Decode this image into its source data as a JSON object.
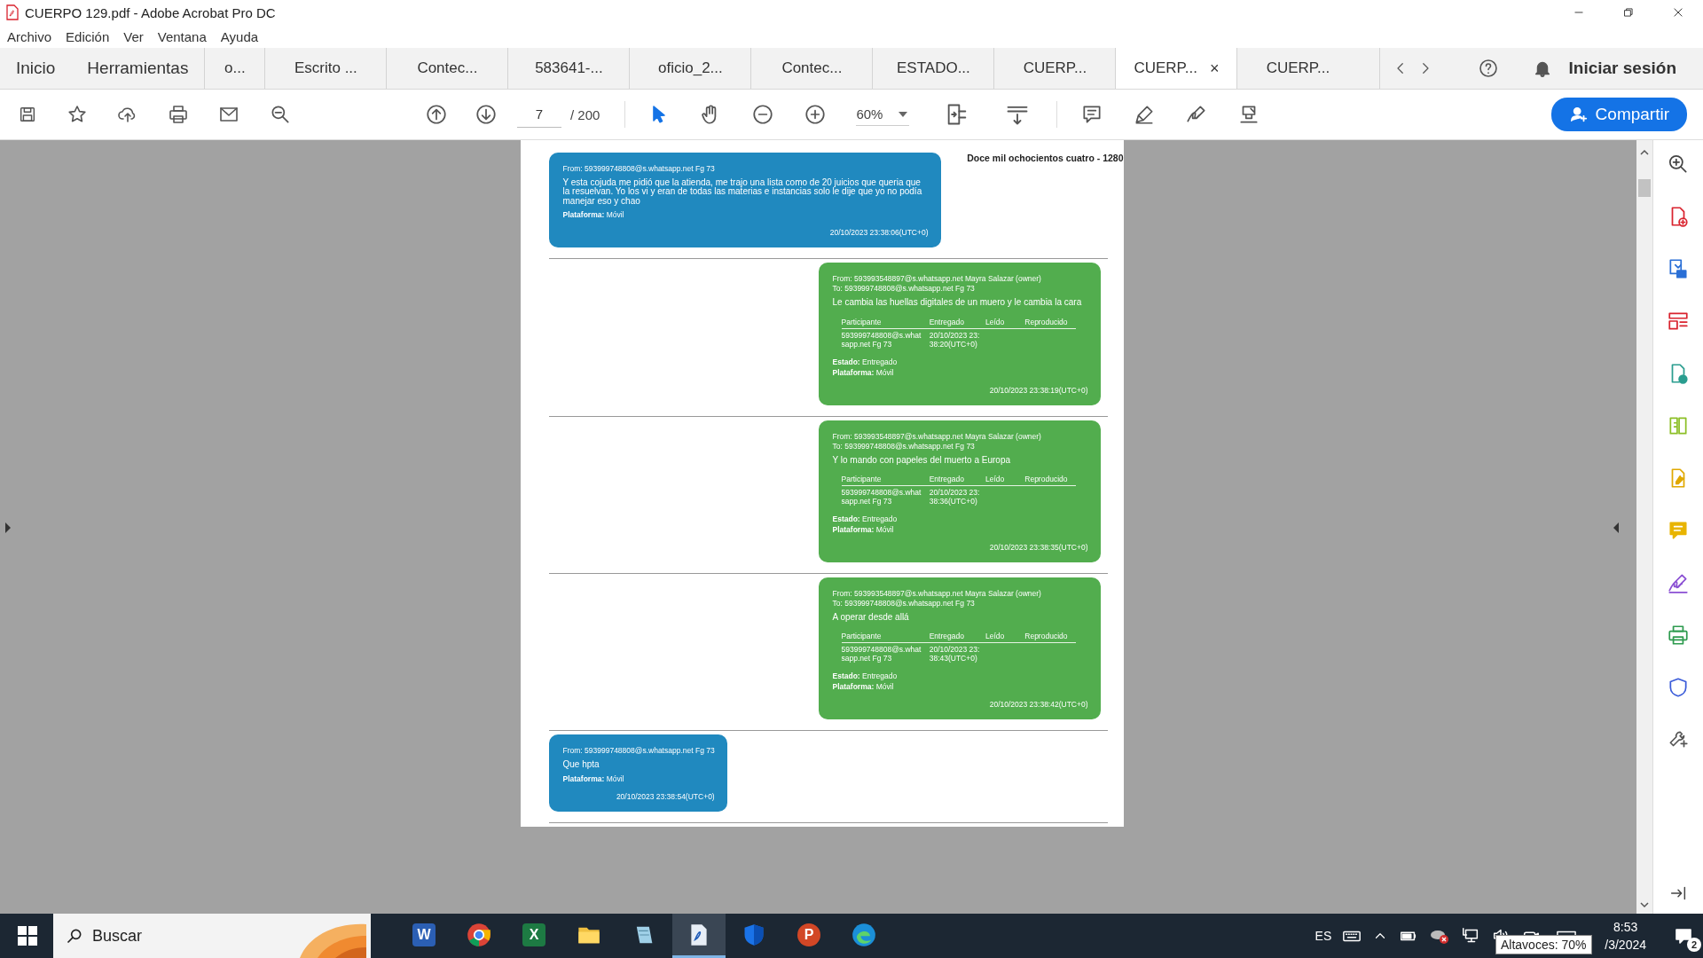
{
  "window": {
    "title": "CUERPO 129.pdf - Adobe Acrobat Pro DC"
  },
  "menu": [
    "Archivo",
    "Edición",
    "Ver",
    "Ventana",
    "Ayuda"
  ],
  "nav_tabs": [
    {
      "label": "Inicio",
      "selected": false
    },
    {
      "label": "Herramientas",
      "selected": false
    }
  ],
  "doc_tabs": [
    {
      "label": "o...",
      "selected": false
    },
    {
      "label": "Escrito ...",
      "selected": false
    },
    {
      "label": "Contec...",
      "selected": false
    },
    {
      "label": "583641-...",
      "selected": false
    },
    {
      "label": "oficio_2...",
      "selected": false
    },
    {
      "label": "Contec...",
      "selected": false
    },
    {
      "label": "ESTADO...",
      "selected": false
    },
    {
      "label": "CUERP...",
      "selected": false
    },
    {
      "label": "CUERP...",
      "selected": true,
      "close": "×"
    },
    {
      "label": "CUERP...",
      "selected": false
    }
  ],
  "sign_in": "Iniciar sesión",
  "toolbar": {
    "page": "7",
    "page_total": "/ 200",
    "zoom": "60%",
    "share": "Compartir"
  },
  "document": {
    "header": "Doce mil ochocientos cuatro - 1280",
    "messages": [
      {
        "kind": "received",
        "from": "From: 593999748808@s.whatsapp.net Fg 73",
        "body": "Y esta cojuda me pidió que la atienda, me trajo una lista como de 20 juicios que queria que la resuelvan. Yo los vi y eran de todas las materias e instancias solo le dije que yo no podía manejar eso y chao",
        "platform": "**Plataforma:** Móvil",
        "timestamp": "20/10/2023 23:38:06(UTC+0)"
      },
      {
        "kind": "sent",
        "from": "From: 593993548897@s.whatsapp.net Mayra Salazar (owner)",
        "to": "To: 593999748808@s.whatsapp.net Fg 73",
        "body": "Le cambia las huellas digitales de un muero y le cambia la cara",
        "columns": [
          "Participante",
          "Entregado",
          "Leído",
          "Reproducido"
        ],
        "row": [
          "593999748808@s.whatsapp.net Fg 73",
          "20/10/2023 23:38:20(UTC+0)"
        ],
        "status": "**Estado:** Entregado",
        "platform": "**Plataforma:** Móvil",
        "timestamp": "20/10/2023 23:38:19(UTC+0)"
      },
      {
        "kind": "sent",
        "from": "From: 593993548897@s.whatsapp.net Mayra Salazar (owner)",
        "to": "To: 593999748808@s.whatsapp.net Fg 73",
        "body": "Y lo mando con papeles del muerto a Europa",
        "columns": [
          "Participante",
          "Entregado",
          "Leído",
          "Reproducido"
        ],
        "row": [
          "593999748808@s.whatsapp.net Fg 73",
          "20/10/2023 23:38:36(UTC+0)"
        ],
        "status": "**Estado:** Entregado",
        "platform": "**Plataforma:** Móvil",
        "timestamp": "20/10/2023 23:38:35(UTC+0)"
      },
      {
        "kind": "sent",
        "from": "From: 593993548897@s.whatsapp.net Mayra Salazar (owner)",
        "to": "To: 593999748808@s.whatsapp.net Fg 73",
        "body": "A operar desde allá",
        "columns": [
          "Participante",
          "Entregado",
          "Leído",
          "Reproducido"
        ],
        "row": [
          "593999748808@s.whatsapp.net Fg 73",
          "20/10/2023 23:38:43(UTC+0)"
        ],
        "status": "**Estado:** Entregado",
        "platform": "**Plataforma:** Móvil",
        "timestamp": "20/10/2023 23:38:42(UTC+0)"
      },
      {
        "kind": "received",
        "from": "From: 593999748808@s.whatsapp.net Fg 73",
        "body": "Que hpta",
        "platform": "**Plataforma:** Móvil",
        "timestamp": "20/10/2023 23:38:54(UTC+0)"
      }
    ]
  },
  "taskbar": {
    "search_placeholder": "Buscar",
    "apps": [
      {
        "kind": "word",
        "letter": "W",
        "selected": false
      },
      {
        "kind": "chrome",
        "selected": false
      },
      {
        "kind": "excel",
        "letter": "X",
        "selected": false
      },
      {
        "kind": "folder",
        "selected": false
      },
      {
        "kind": "notes",
        "selected": false
      },
      {
        "kind": "pdf",
        "selected": true
      },
      {
        "kind": "shield",
        "selected": false
      },
      {
        "kind": "powerpoint",
        "letter": "P",
        "selected": false
      },
      {
        "kind": "edge",
        "selected": false
      }
    ],
    "language": "ES",
    "time": "8:53",
    "date": "/3/2024",
    "notifications": "2",
    "tooltip": "Altavoces: 70%"
  }
}
